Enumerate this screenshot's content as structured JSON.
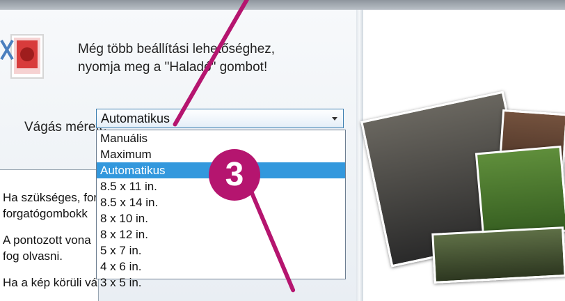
{
  "hint": {
    "line1": "Még több beállítási lehetőséghez,",
    "line2": "nyomja meg a \"Haladó\" gombot!"
  },
  "crop": {
    "label": "Vágás mérete:",
    "selected": "Automatikus",
    "options": [
      "Manuális",
      "Maximum",
      "Automatikus",
      "8.5 x 11 in.",
      "8.5 x 14 in.",
      "8 x 10 in.",
      "8 x 12 in.",
      "5 x 7 in.",
      "4 x 6 in.",
      "3 x 5 in."
    ]
  },
  "description": [
    "Ha szükséges, for",
    "forgatógombokk",
    "A pontozott vona",
    "fog olvasni.",
    "Ha a kép körüli vá"
  ],
  "callout": {
    "number": "3"
  },
  "colors": {
    "accent": "#b5156f",
    "selection": "#3398dd"
  },
  "icons": {
    "stamp": "stamp-crop-icon"
  }
}
